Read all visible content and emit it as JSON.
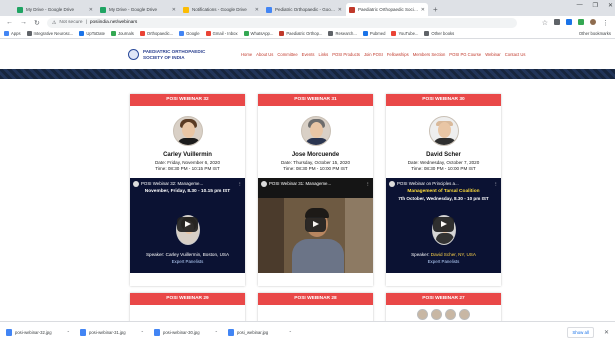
{
  "browser": {
    "tabs": [
      {
        "title": "My Drive - Google Drive",
        "color": "#1fa463",
        "active": false
      },
      {
        "title": "My Drive - Google Drive",
        "color": "#1fa463",
        "active": false
      },
      {
        "title": "Notifications - Google Drive",
        "color": "#fbbc04",
        "active": false
      },
      {
        "title": "Pediatric Orthopaedic - Google Search",
        "color": "#4285f4",
        "active": false
      },
      {
        "title": "Paediatric Orthopaedic Society o...",
        "color": "#c0392b",
        "active": true
      }
    ],
    "new_tab": "+",
    "window_controls": [
      "—",
      "❐",
      "✕"
    ],
    "url_security": "Not secure",
    "url": "posiindia.net/webinars",
    "bookmarks": [
      {
        "label": "Apps",
        "color": "#4285f4"
      },
      {
        "label": "Integrative Neurosc...",
        "color": "#5f6368"
      },
      {
        "label": "UpToDate",
        "color": "#1a73e8"
      },
      {
        "label": "Journals",
        "color": "#34a853"
      },
      {
        "label": "Orthopaedic...",
        "color": "#ea4335"
      },
      {
        "label": "Google",
        "color": "#4285f4"
      },
      {
        "label": "Gmail - Inbox",
        "color": "#ea4335"
      },
      {
        "label": "WhatsApp...",
        "color": "#34a853"
      },
      {
        "label": "Paediatric Orthop...",
        "color": "#c0392b"
      },
      {
        "label": "Research...",
        "color": "#5f6368"
      },
      {
        "label": "Pubmed",
        "color": "#1a73e8"
      },
      {
        "label": "YouTube...",
        "color": "#ea4335"
      },
      {
        "label": "Other books",
        "color": "#5f6368"
      }
    ],
    "bookmarks_right": "Other bookmarks"
  },
  "site": {
    "brand_line1": "PAEDIATRIC ORTHOPAEDIC",
    "brand_line2": "SOCIETY OF INDIA",
    "nav": [
      "Home",
      "About Us",
      "Committee",
      "Events",
      "Links",
      "POSI Products",
      "Join POSI",
      "Fellowships",
      "Members Section",
      "POSI PG Course",
      "Webinar",
      "Contact Us"
    ]
  },
  "cards": [
    {
      "header": "POSI WEBINAR 32",
      "name": "Carley Vuillermin",
      "date": "Date: Friday, November 6, 2020",
      "time": "Time: 08:30 PM - 10:15 PM IST",
      "video_title": "POSI Webinar 32: Manageme...",
      "video_sub": "November, Friday, 8.30 - 10.15 pm IST",
      "speaker_prefix": "Speaker:",
      "speaker": "Carley Vuillermin, Boston, USA",
      "panel": "Expert Panelists"
    },
    {
      "header": "POSI WEBINAR 31",
      "name": "Jose Morcuende",
      "date": "Date: Thursday, October 15, 2020",
      "time": "Time: 08:30 PM - 10:00 PM IST",
      "video_title": "POSI Webinar 31: Manageme..."
    },
    {
      "header": "POSI WEBINAR 30",
      "name": "David Scher",
      "date": "Date: Wednesday, October 7, 2020",
      "time": "Time: 08:30 PM - 10:00 PM IST",
      "video_title": "POSI Webinar on Principles a...",
      "video_sub": "Management of Tarsal Coalition",
      "video_sub2": "7th October, Wednesday, 8.30 - 10 pm IST",
      "speaker_prefix": "Speaker:",
      "speaker": "David Scher, NY, USA",
      "panel": "Expert Panelists"
    }
  ],
  "cards_row2": [
    {
      "header": "POSI WEBINAR 29"
    },
    {
      "header": "POSI WEBINAR 28"
    },
    {
      "header": "POSI WEBINAR 27"
    }
  ],
  "downloads": [
    {
      "label": "posi-webinar-32.jpg"
    },
    {
      "label": "posi-webinar-31.jpg"
    },
    {
      "label": "posi-webinar-30.jpg"
    },
    {
      "label": "posi_webinar.jpg"
    }
  ],
  "downloads_show_all": "Show all"
}
